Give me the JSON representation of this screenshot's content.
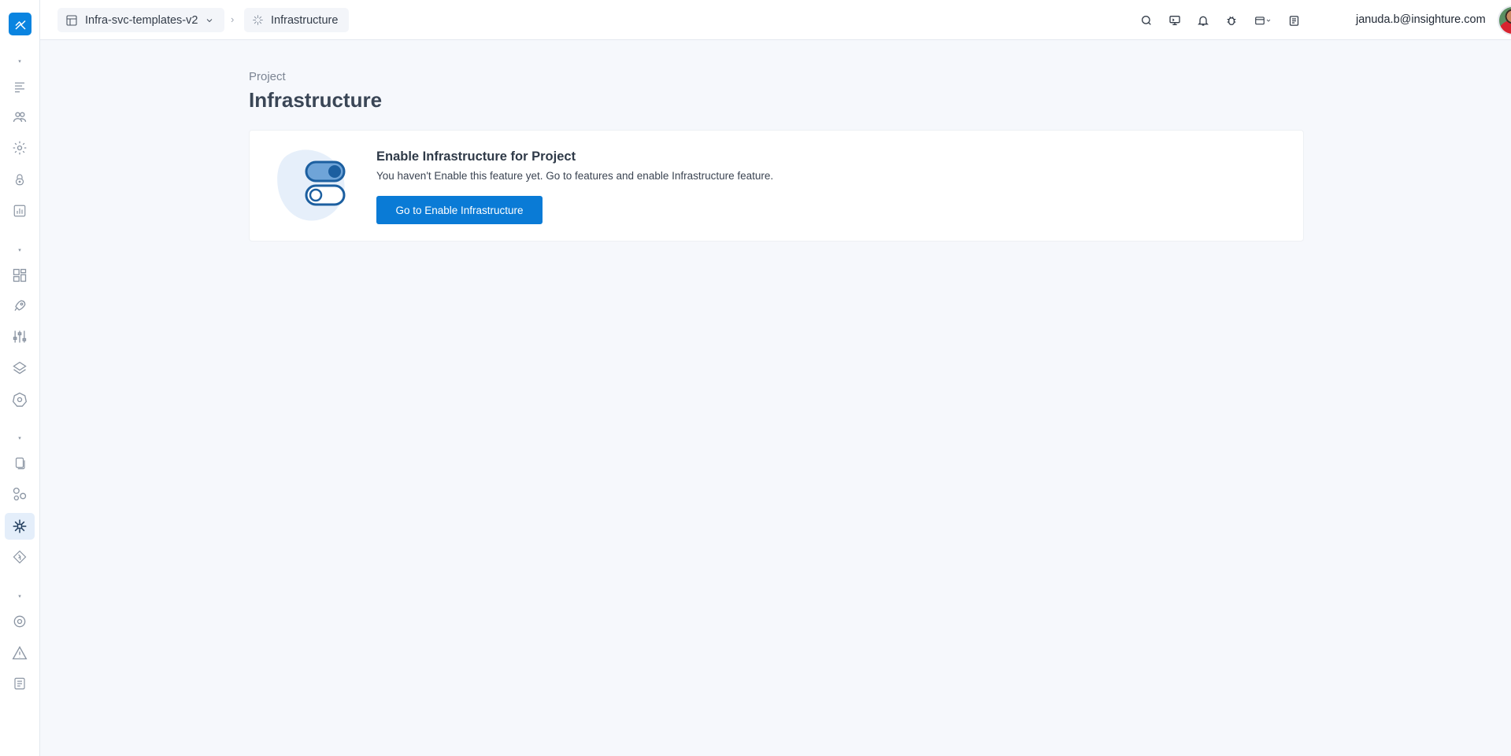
{
  "breadcrumb": {
    "project_name": "Infra-svc-templates-v2",
    "current_page": "Infrastructure"
  },
  "header": {
    "user_email": "januda.b@insighture.com"
  },
  "page": {
    "eyebrow": "Project",
    "title": "Infrastructure"
  },
  "empty_state": {
    "title": "Enable Infrastructure for Project",
    "description": "You haven't Enable this feature yet. Go to features and enable Infrastructure feature.",
    "button_label": "Go to Enable Infrastructure"
  },
  "sidebar": {
    "active_item": "infrastructure",
    "icons": [
      "list-icon",
      "users-icon",
      "gear-icon",
      "lock-icon",
      "bar-chart-icon",
      "dashboard-icon",
      "rocket-icon",
      "sliders-icon",
      "layers-icon",
      "kubernetes-icon",
      "documents-icon",
      "components-icon",
      "infrastructure-icon",
      "git-icon",
      "settings-icon",
      "warning-icon",
      "notes-icon"
    ]
  },
  "colors": {
    "accent": "#0a7bd6",
    "background": "#f6f8fc"
  }
}
